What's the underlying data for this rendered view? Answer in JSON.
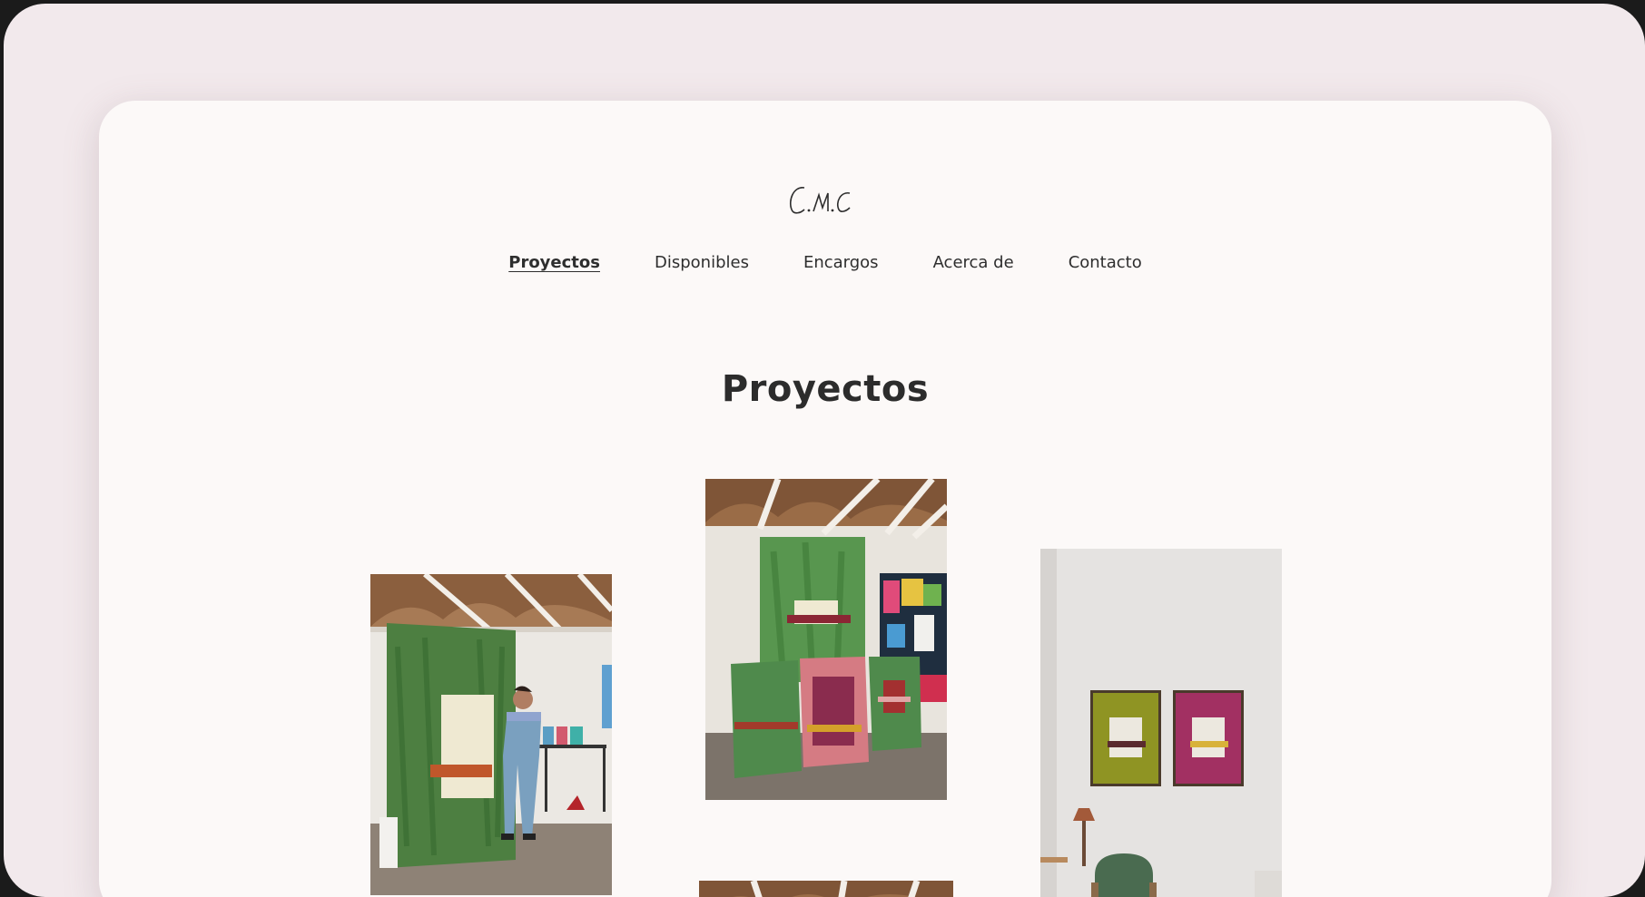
{
  "site": {
    "logo_text": "C.M.C"
  },
  "nav": {
    "items": [
      {
        "label": "Proyectos",
        "active": true
      },
      {
        "label": "Disponibles"
      },
      {
        "label": "Encargos"
      },
      {
        "label": "Acerca de"
      },
      {
        "label": "Contacto"
      }
    ]
  },
  "main": {
    "title": "Proyectos"
  },
  "colors": {
    "page_bg": "#fcf9f8",
    "outer_bg": "#f2e9ec",
    "text": "#2e2e2e",
    "green_canvas": "#4f8a4c",
    "rose_canvas": "#c76b78",
    "magenta_canvas": "#a12d5a",
    "olive_canvas": "#8a8f1e"
  }
}
